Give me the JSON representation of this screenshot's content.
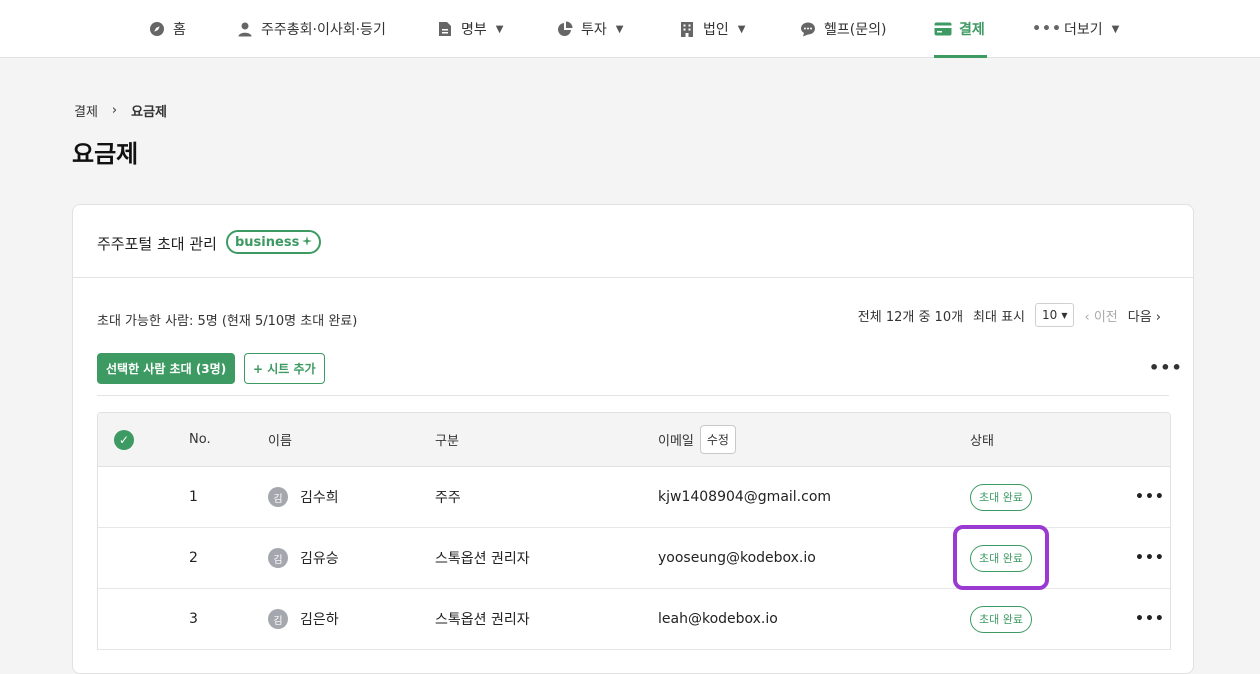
{
  "nav": {
    "items": [
      {
        "label": "홈",
        "icon": "compass-icon",
        "dropdown": false,
        "active": false
      },
      {
        "label": "주주총회·이사회·등기",
        "icon": "person-icon",
        "dropdown": false,
        "active": false
      },
      {
        "label": "명부",
        "icon": "document-icon",
        "dropdown": true,
        "active": false
      },
      {
        "label": "투자",
        "icon": "pie-chart-icon",
        "dropdown": true,
        "active": false
      },
      {
        "label": "법인",
        "icon": "building-icon",
        "dropdown": true,
        "active": false
      },
      {
        "label": "헬프(문의)",
        "icon": "chat-bubble-icon",
        "dropdown": false,
        "active": false
      },
      {
        "label": "결제",
        "icon": "credit-card-icon",
        "dropdown": false,
        "active": true
      },
      {
        "label": "더보기",
        "icon": "more-dots-icon",
        "dropdown": true,
        "active": false
      }
    ]
  },
  "breadcrumb": {
    "parent": "결제",
    "separator": "›",
    "current": "요금제"
  },
  "page_title": "요금제",
  "card": {
    "title": "주주포털 초대 관리",
    "badge": "business",
    "invite_info": "초대 가능한 사람: 5명 (현재 5/10명 초대 완료)",
    "pager": {
      "total": "전체 12개 중 10개",
      "page_size_label": "최대 표시",
      "page_size": "10",
      "prev": "이전",
      "next": "다음"
    },
    "invite_button": "선택한 사람 초대 (3명)",
    "add_seat_button": "+ 시트 추가"
  },
  "table": {
    "headers": {
      "no": "No.",
      "name": "이름",
      "type": "구분",
      "email": "이메일",
      "email_edit": "수정",
      "status": "상태"
    },
    "rows": [
      {
        "no": "1",
        "avatar": "김",
        "name": "김수희",
        "type": "주주",
        "email": "kjw1408904@gmail.com",
        "status": "초대 완료"
      },
      {
        "no": "2",
        "avatar": "김",
        "name": "김유승",
        "type": "스톡옵션 권리자",
        "email": "yooseung@kodebox.io",
        "status": "초대 완료"
      },
      {
        "no": "3",
        "avatar": "김",
        "name": "김은하",
        "type": "스톡옵션 권리자",
        "email": "leah@kodebox.io",
        "status": "초대 완료"
      }
    ]
  },
  "colors": {
    "accent": "#3d9a63",
    "highlight": "#9a3ad0"
  }
}
